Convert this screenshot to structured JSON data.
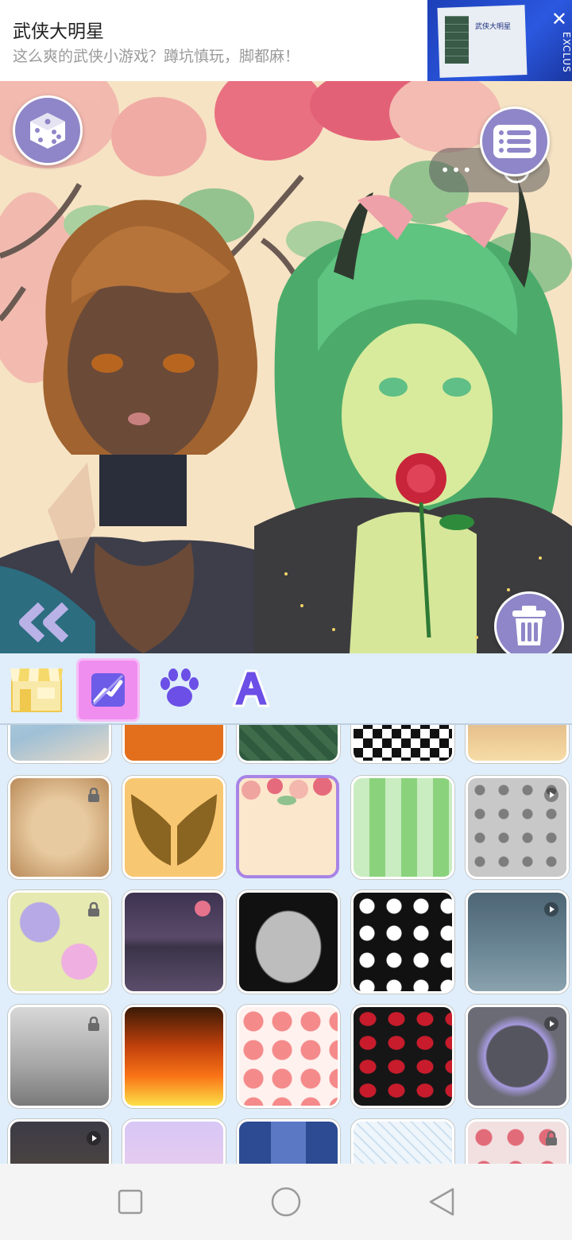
{
  "ad": {
    "title": "武侠大明星",
    "subtitle": "这么爽的武侠小游戏？蹲坑慎玩，脚都麻！",
    "thumb_caption": "武侠大明星",
    "thumb_side_text": "EXCLUS"
  },
  "capsule": {
    "dots": "•••"
  },
  "icons": {
    "dice": "dice-icon",
    "menu": "list-menu-icon",
    "trash": "trash-icon",
    "back": "double-chevron-left-icon",
    "shop": "shop-icon",
    "background": "background-icon",
    "paw": "paw-icon",
    "text": "text-a-icon",
    "lock": "lock-icon",
    "play": "play-icon"
  },
  "colors": {
    "accent_purple": "#8e86c8",
    "selected_tab": "#f08ef0",
    "tab_bar_bg": "#dfeefa",
    "selected_cell_border": "#a884e6"
  }
}
